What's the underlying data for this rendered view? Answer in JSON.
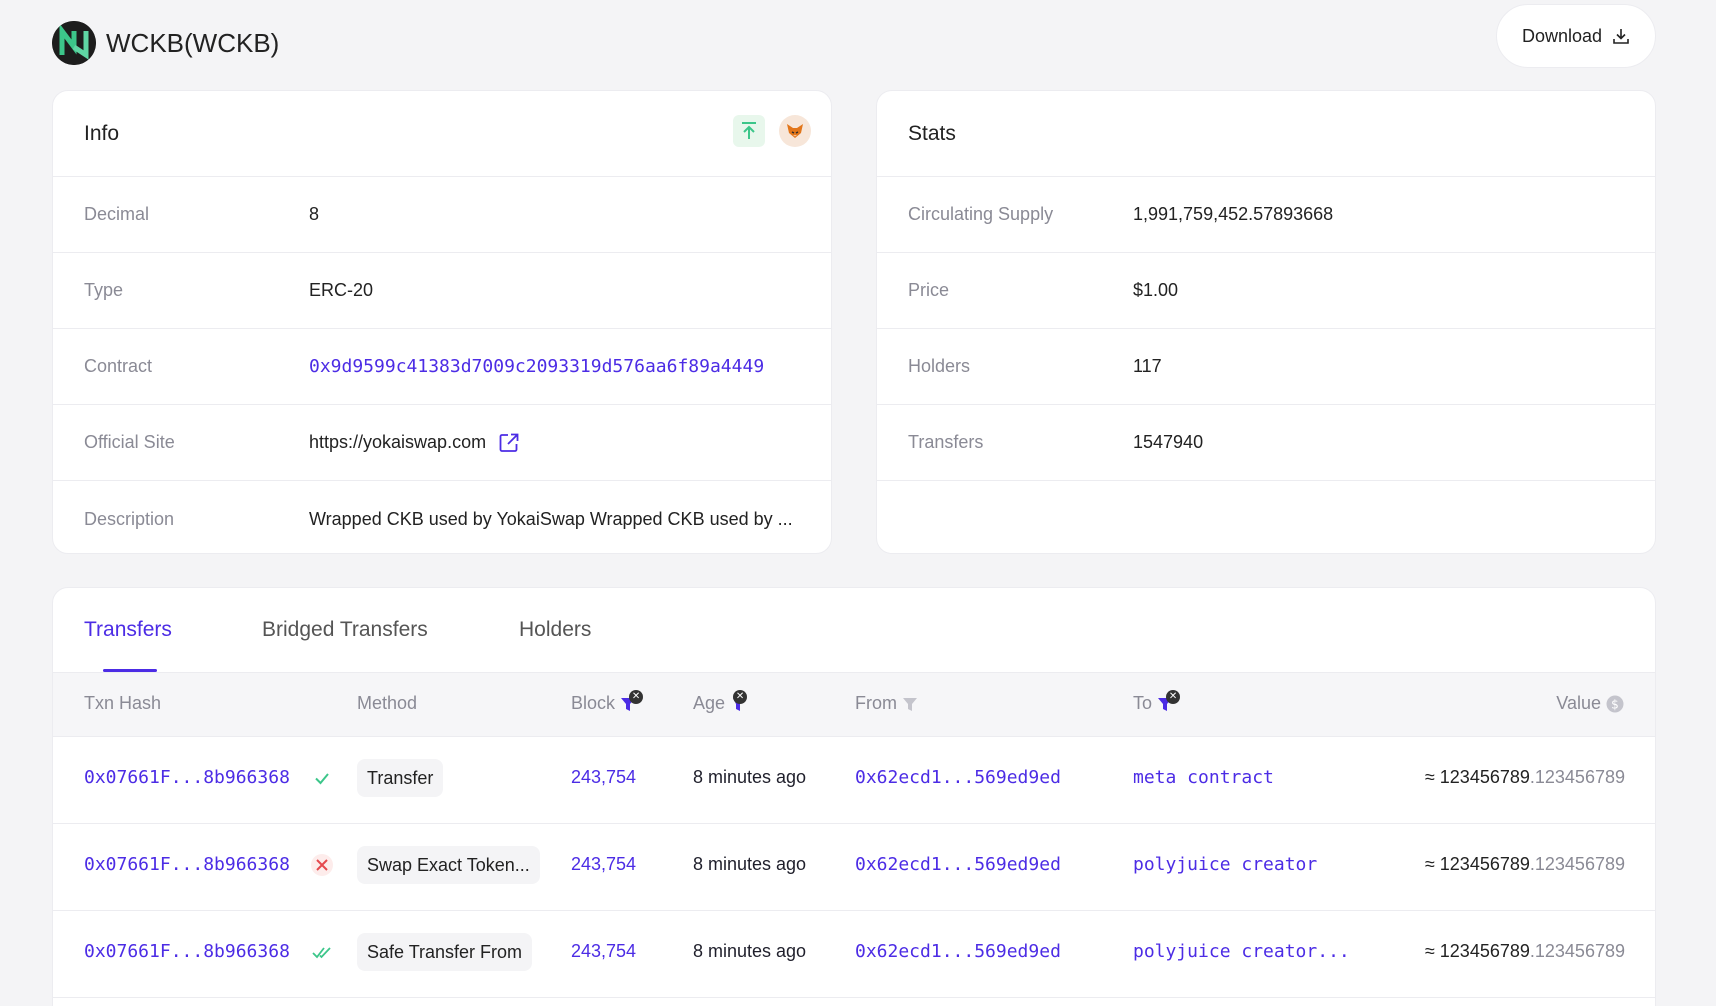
{
  "header": {
    "title": "WCKB(WCKB)",
    "download_label": "Download"
  },
  "info": {
    "title": "Info",
    "rows": [
      {
        "label": "Decimal",
        "value": "8"
      },
      {
        "label": "Type",
        "value": "ERC-20"
      },
      {
        "label": "Contract",
        "value": "0x9d9599c41383d7009c2093319d576aa6f89a4449"
      },
      {
        "label": "Official Site",
        "value": "https://yokaiswap.com"
      },
      {
        "label": "Description",
        "value": "Wrapped CKB used by YokaiSwap Wrapped CKB used by ..."
      }
    ]
  },
  "stats": {
    "title": "Stats",
    "rows": [
      {
        "label": "Circulating Supply",
        "value": "1,991,759,452.57893668"
      },
      {
        "label": "Price",
        "value": "$1.00"
      },
      {
        "label": "Holders",
        "value": "117"
      },
      {
        "label": "Transfers",
        "value": "1547940"
      }
    ]
  },
  "tabs": [
    {
      "label": "Transfers",
      "active": true
    },
    {
      "label": "Bridged Transfers",
      "active": false
    },
    {
      "label": "Holders",
      "active": false
    }
  ],
  "columns": {
    "txn_hash": "Txn Hash",
    "method": "Method",
    "block": "Block",
    "age": "Age",
    "from": "From",
    "to": "To",
    "value": "Value"
  },
  "transfers": [
    {
      "hash": "0x07661F...8b966368",
      "status": "success",
      "method": "Transfer",
      "block": "243,754",
      "age": "8 minutes ago",
      "from": "0x62ecd1...569ed9ed",
      "to": "meta contract",
      "value_int": "≈ 123456789",
      "value_dec": ".123456789"
    },
    {
      "hash": "0x07661F...8b966368",
      "status": "failed",
      "method": "Swap Exact Token...",
      "block": "243,754",
      "age": "8 minutes ago",
      "from": "0x62ecd1...569ed9ed",
      "to": "polyjuice creator",
      "value_int": "≈ 123456789",
      "value_dec": ".123456789"
    },
    {
      "hash": "0x07661F...8b966368",
      "status": "finalized",
      "method": "Safe Transfer From",
      "block": "243,754",
      "age": "8 minutes ago",
      "from": "0x62ecd1...569ed9ed",
      "to": "polyjuice creator...",
      "value_int": "≈ 123456789",
      "value_dec": ".123456789"
    }
  ],
  "colors": {
    "accent": "#4c2ce5",
    "success": "#3cc68a",
    "error": "#e5484d"
  }
}
